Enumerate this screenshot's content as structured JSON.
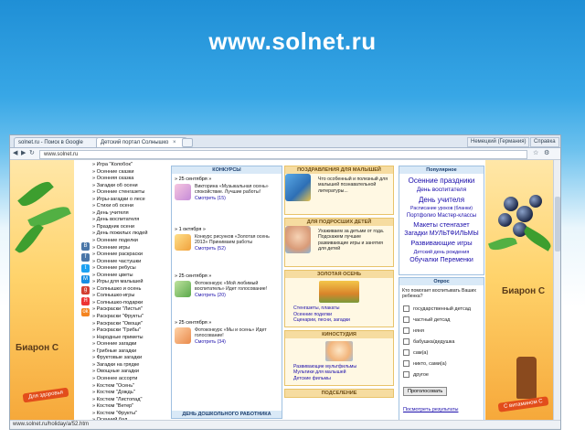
{
  "slide": {
    "title": "www.solnet.ru"
  },
  "browser": {
    "tabs": [
      {
        "label": "solnet.ru - Поиск в Google",
        "close": "×"
      },
      {
        "label": "Детский портал Солнышко",
        "close": "×"
      }
    ],
    "window_buttons": [
      "Немецкий (Германия)",
      "Справка"
    ],
    "nav": {
      "back": "◀",
      "forward": "▶",
      "reload": "↻",
      "star": "☆",
      "wrench": "⚙"
    },
    "url": "www.solnet.ru",
    "status": "www.solnet.ru/holiday/a/52.htm"
  },
  "ads": {
    "left": {
      "brand": "Биарон С",
      "badge": "Для здоровья"
    },
    "right": {
      "brand": "Биарон С",
      "badge": "С витамином С"
    }
  },
  "share_icons": [
    "В",
    "f",
    "t",
    "М",
    "g",
    "Я",
    "ok"
  ],
  "menu": [
    "» Игра \"Колобок\"",
    "» Осенние сказки",
    "» Осенняя сказка",
    "» Загадки об осени",
    "» Осенние стенгазеты",
    "» Игры-загадки о лесе",
    "» Стихи об осени",
    "» День учителя",
    "» День воспитателя",
    "» Праздник осени",
    "» День пожилых людей",
    "» Осенние поделки",
    "» Осенние игры",
    "» Осенние раскраски",
    "» Осенние частушки",
    "» Осенние ребусы",
    "» Осенние цветы",
    "» Игры для малышей",
    "» Солнышко и осень",
    "» Солнышко-игры",
    "» Солнышко-подарки",
    "» Раскраски \"Листья\"",
    "» Раскраски \"Фрукты\"",
    "» Раскраски \"Овощи\"",
    "» Раскраски \"Грибы\"",
    "» Народные приметы",
    "» Осенние загадки",
    "» Грибные загадки",
    "» Фруктовые загадки",
    "» Загадки на грядке",
    "» Овощные загадки",
    "» Осеннее ассорти",
    "» Костюм \"Осень\"",
    "» Костюм \"Дождь\"",
    "» Костюм \"Листопад\"",
    "» Костюм \"Ветер\"",
    "» Костюм \"Фрукты\"",
    "» Осенний бал"
  ],
  "contests": {
    "header": "КОНКУРСЫ",
    "footer_header": "ДЕНЬ ДОШКОЛЬНОГО РАБОТНИКА",
    "entries": [
      {
        "date": "» 25 сентября »",
        "text": "Викторина «Музыкальная осень» спокойствие. Лучшие работы!",
        "meta": "Смотреть (15)"
      },
      {
        "date": "» 1 октября »",
        "text": "Конкурс рисунков «Золотая осень 2013» Принимаем работы",
        "meta": "Смотреть (52)"
      },
      {
        "date": "» 25 сентября »",
        "text": "Фотоконкурс «Мой любимый воспитатель» Идет голосование!",
        "meta": "Смотреть (20)"
      },
      {
        "date": "» 25 сентября »",
        "text": "Фотоконкурс «Мы и осень» Идет голосование!",
        "meta": "Смотреть (34)"
      }
    ]
  },
  "center": {
    "news": {
      "header": "ПОЗДРАВЛЕНИЯ ДЛЯ МАЛЫШЕЙ",
      "text": "Что особенный и полезный для малышей познавательной литературы..."
    },
    "parents": {
      "header": "ДЛЯ ПОДРОСШИХ ДЕТЕЙ",
      "text": "Ухаживаем за детьми от года. Подскажем лучшие развивающие игры и занятия для детей"
    },
    "golden_autumn": {
      "header": "ЗОЛОТАЯ ОСЕНЬ",
      "links": [
        "Стенгазеты, плакаты",
        "Осенние поделки",
        "Сценарии, песни, загадки"
      ]
    },
    "crafts": {
      "header": "КИНОСТУДИЯ",
      "links": [
        "Развивающие мультфильмы",
        "Мультики для малышей",
        "Детские фильмы"
      ]
    },
    "bottom": {
      "header": "ПОДСЕЛЕНИЕ"
    }
  },
  "popular": {
    "header": "Популярное",
    "items": [
      {
        "label": "Осенние праздники",
        "size": 8,
        "color": "#1a0dab"
      },
      {
        "label": "День воспитателя",
        "size": 6.5,
        "color": "#1a0dab"
      },
      {
        "label": "День учителя",
        "size": 8,
        "color": "#1a0dab"
      },
      {
        "label": "Расписание уроков (бланки)",
        "size": 5.2,
        "color": "#1a0dab"
      },
      {
        "label": "Портфолио  Мастер-классы",
        "size": 6,
        "color": "#1a0dab"
      },
      {
        "label": "Макеты стенгазет",
        "size": 7.5,
        "color": "#1a0dab"
      },
      {
        "label": "Загадки  МУЛЬТФИЛЬМЫ",
        "size": 7,
        "color": "#1a0dab"
      },
      {
        "label": "Развивающие игры",
        "size": 7.5,
        "color": "#1a0dab"
      },
      {
        "label": "Детский день рождения",
        "size": 5.5,
        "color": "#1a0dab"
      },
      {
        "label": "Обучалки Переменки",
        "size": 7,
        "color": "#1a0dab"
      }
    ]
  },
  "poll": {
    "header": "Опрос",
    "question": "Кто помогает воспитывать Ваших ребенка?",
    "options": [
      "государственный детсад",
      "частный детсад",
      "няня",
      "бабушка/дедушка",
      "сам(а)",
      "никто, сами(а)",
      "другое"
    ],
    "vote_label": "Проголосовать",
    "results_label": "Посмотреть результаты"
  },
  "colors": {
    "slide_top": "#1f8fd6",
    "link": "#1a0dab",
    "panel_border": "#9fc0e0"
  }
}
